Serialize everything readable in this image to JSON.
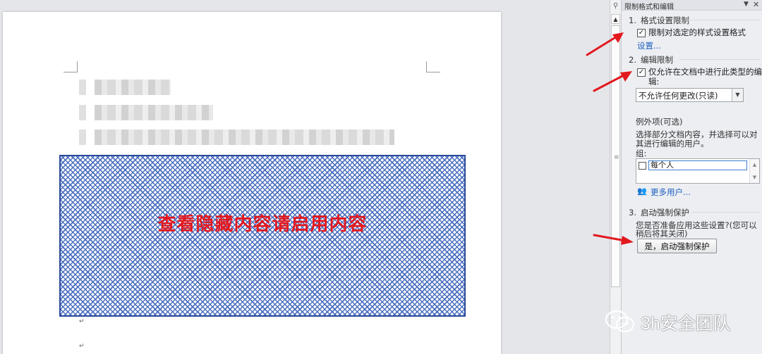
{
  "document": {
    "notice_text": "查看隐藏内容请启用内容",
    "paragraph_mark": "↵"
  },
  "panel": {
    "title": "限制格式和编辑",
    "menu_icon": "dropdown-triangle-icon",
    "close_icon": "close-icon",
    "section1": {
      "number": "1.",
      "title": "格式设置限制",
      "checkbox_label": "限制对选定的样式设置格式",
      "checked": true,
      "settings_link": "设置..."
    },
    "section2": {
      "number": "2.",
      "title": "编辑限制",
      "checkbox_label_line1": "仅允许在文档中进行此类型的编",
      "checkbox_label_line2": "辑:",
      "checked": true,
      "select_value": "不允许任何更改(只读)",
      "exceptions_title": "例外项(可选)",
      "exceptions_desc_line1": "选择部分文档内容，并选择可以对",
      "exceptions_desc_line2": "其进行编辑的用户。",
      "group_label": "组:",
      "group_items": [
        "每个人"
      ],
      "more_users_link": "更多用户..."
    },
    "section3": {
      "number": "3.",
      "title": "启动强制保护",
      "desc_line1": "您是否准备应用这些设置?(您可以",
      "desc_line2": "稍后将其关闭)",
      "button_label": "是，启动强制保护"
    }
  },
  "annotations": {
    "arrow_color": "#e3181f"
  },
  "watermark": {
    "text": "3h安全团队"
  }
}
